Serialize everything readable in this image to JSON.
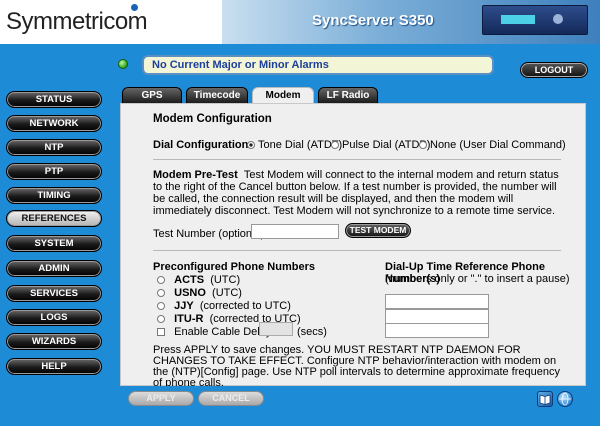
{
  "header": {
    "logo": "Symmetricom",
    "product_title": "SyncServer S350"
  },
  "alarm": {
    "text": "No Current Major or Minor Alarms"
  },
  "logout_label": "LOGOUT",
  "nav": [
    {
      "label": "STATUS",
      "active": false
    },
    {
      "label": "NETWORK",
      "active": false
    },
    {
      "label": "NTP",
      "active": false
    },
    {
      "label": "PTP",
      "active": false
    },
    {
      "label": "TIMING",
      "active": false
    },
    {
      "label": "REFERENCES",
      "active": true
    },
    {
      "label": "SYSTEM",
      "active": false
    },
    {
      "label": "ADMIN",
      "active": false
    },
    {
      "label": "SERVICES",
      "active": false
    },
    {
      "label": "LOGS",
      "active": false
    },
    {
      "label": "WIZARDS",
      "active": false
    },
    {
      "label": "HELP",
      "active": false
    }
  ],
  "tabs": [
    {
      "label": "GPS",
      "active": false
    },
    {
      "label": "Timecode",
      "active": false
    },
    {
      "label": "Modem",
      "active": true
    },
    {
      "label": "LF Radio",
      "active": false
    }
  ],
  "modem": {
    "title": "Modem Configuration",
    "dial_config_label": "Dial Configuration",
    "dial_options": [
      {
        "label": "Tone Dial (ATDT)",
        "checked": true
      },
      {
        "label": "Pulse Dial (ATDP)",
        "checked": false
      },
      {
        "label": "None (User Dial Command)",
        "checked": false
      }
    ],
    "pretest_label": "Modem Pre-Test",
    "pretest_text": "Test Modem will connect to the internal modem and return status to the right of the Cancel button below. If a test number is provided, the number will be called, the connection result will be displayed, and then the modem will immediately disconnect. Test Modem will not synchronize to a remote time service.",
    "test_number_label": "Test Number (optional)",
    "test_number_value": "",
    "test_button": "TEST MODEM",
    "preconfig_title": "Preconfigured Phone Numbers",
    "preconfig": [
      {
        "name": "ACTS",
        "note": "(UTC)"
      },
      {
        "name": "USNO",
        "note": "(UTC)"
      },
      {
        "name": "JJY",
        "note": "(corrected to UTC)"
      },
      {
        "name": "ITU-R",
        "note": "(corrected to UTC)"
      }
    ],
    "cable_delay_label": "Enable Cable Delay",
    "cable_delay_value": "",
    "cable_delay_unit": "(secs)",
    "dialup_title": "Dial-Up Time Reference Phone Number(s)",
    "dialup_hint": "(numbers only or \".\" to insert a pause)",
    "phone_values": [
      "",
      "",
      "",
      ""
    ],
    "footer_note": "Press APPLY to save changes. YOU MUST RESTART NTP DAEMON FOR CHANGES TO TAKE EFFECT. Configure NTP behavior/interaction with modem on the (NTP)[Config] page. Use NTP poll intervals to determine approximate frequency of phone calls."
  },
  "buttons": {
    "apply": "APPLY",
    "cancel": "CANCEL"
  },
  "icons": {
    "book": "help-book-icon",
    "globe": "globe-icon"
  }
}
